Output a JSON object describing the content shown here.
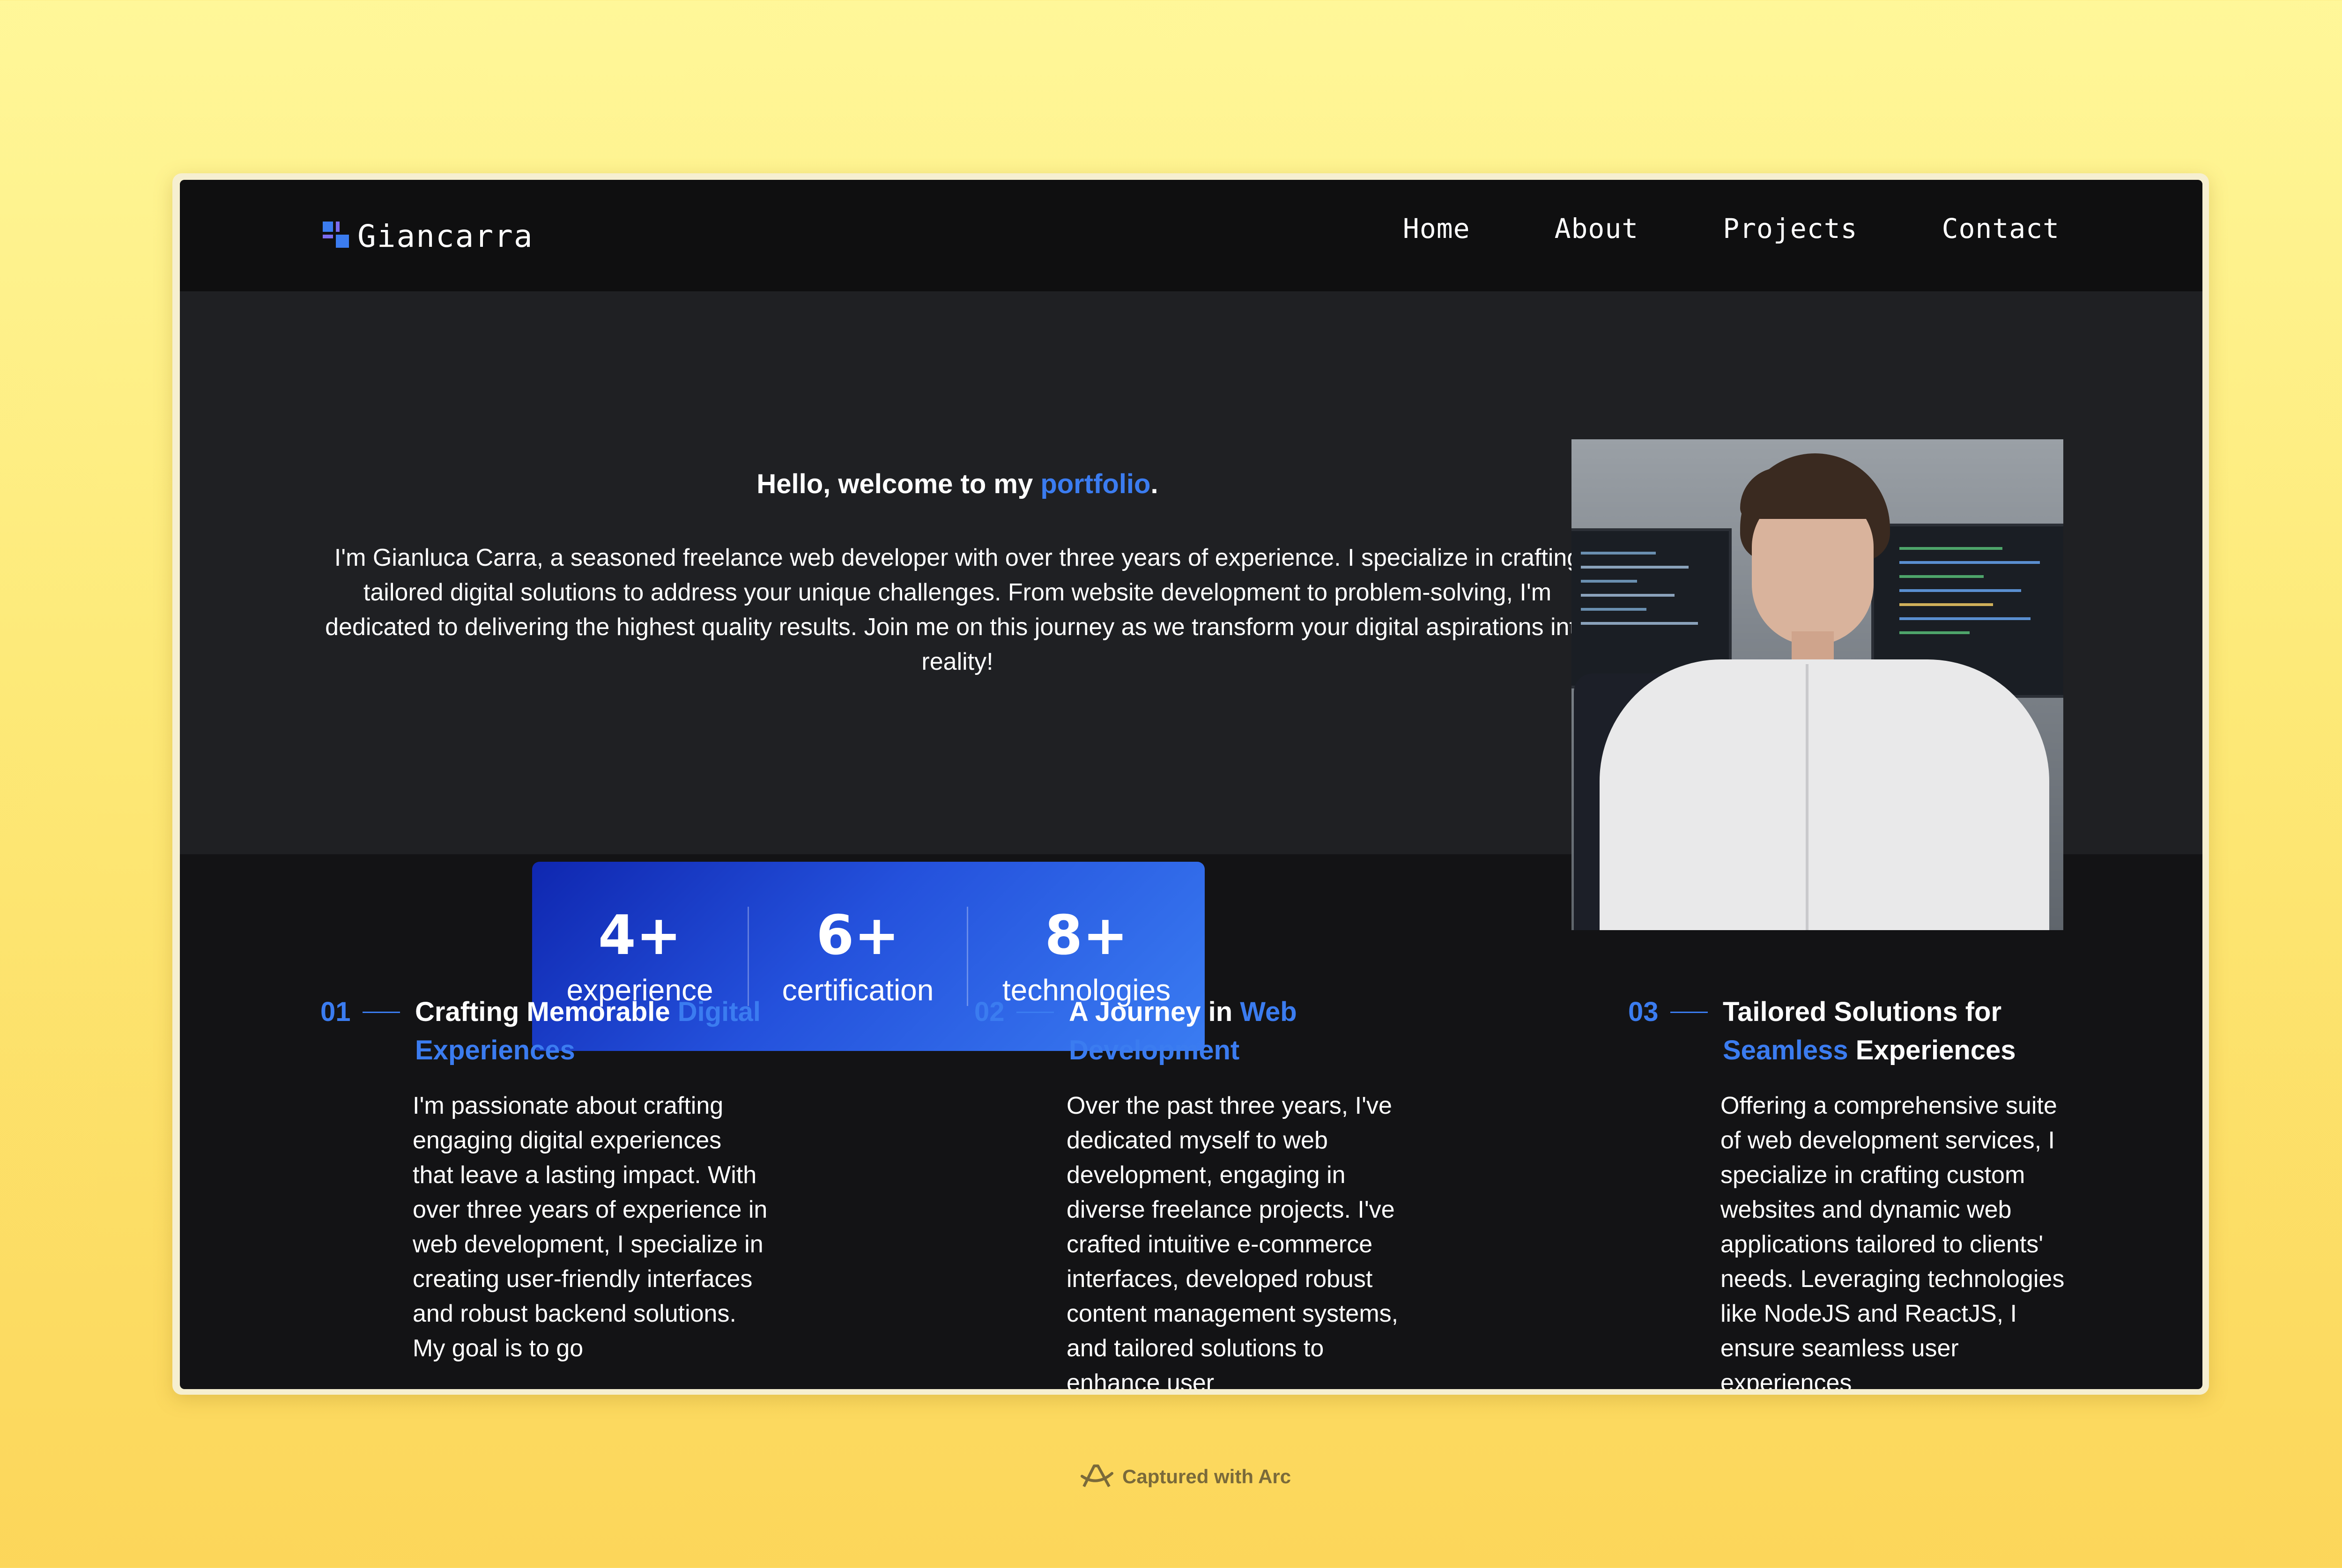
{
  "header": {
    "logo_text": "Giancarra",
    "nav": [
      {
        "label": "Home"
      },
      {
        "label": "About"
      },
      {
        "label": "Projects"
      },
      {
        "label": "Contact"
      }
    ]
  },
  "hero": {
    "title_prefix": "Hello, welcome to my ",
    "title_accent": "portfolio",
    "title_suffix": ".",
    "intro": "I'm Gianluca Carra, a seasoned freelance web developer with over three years of experience. I specialize in crafting tailored digital solutions to address your unique challenges. From website development to problem-solving, I'm dedicated to delivering the highest quality results. Join me on this journey as we transform your digital aspirations into reality!",
    "stats": [
      {
        "value": "4+",
        "label": "experience"
      },
      {
        "value": "6+",
        "label": "certification"
      },
      {
        "value": "8+",
        "label": "technologies"
      }
    ]
  },
  "features": [
    {
      "number": "01",
      "title_a": "Crafting Memorable ",
      "title_accent": "Digital Experiences",
      "title_b": "",
      "body": "I'm passionate about crafting engaging digital experiences that leave a lasting impact. With over three years of experience in web development, I specialize in creating user-friendly interfaces and robust backend solutions. My goal is to go"
    },
    {
      "number": "02",
      "title_a": "A Journey in ",
      "title_accent": "Web Development",
      "title_b": "",
      "body": "Over the past three years, I've dedicated myself to web development, engaging in diverse freelance projects. I've crafted intuitive e-commerce interfaces, developed robust content management systems, and tailored solutions to enhance user"
    },
    {
      "number": "03",
      "title_a": "Tailored Solutions for ",
      "title_accent": "Seamless",
      "title_b": " Experiences",
      "body": "Offering a comprehensive suite of web development services, I specialize in crafting custom websites and dynamic web applications tailored to clients' needs. Leveraging technologies like NodeJS and ReactJS, I ensure seamless user experiences"
    }
  ],
  "footer": {
    "capture_text": "Captured with Arc"
  },
  "colors": {
    "accent": "#3b7cf0",
    "header_bg": "#0f0f10",
    "hero_bg": "#1f2023",
    "body_bg": "#131315"
  },
  "icons": {
    "logo": "logo-mark-icon",
    "portrait": "developer-portrait-image",
    "capture": "arc-logo-icon"
  }
}
